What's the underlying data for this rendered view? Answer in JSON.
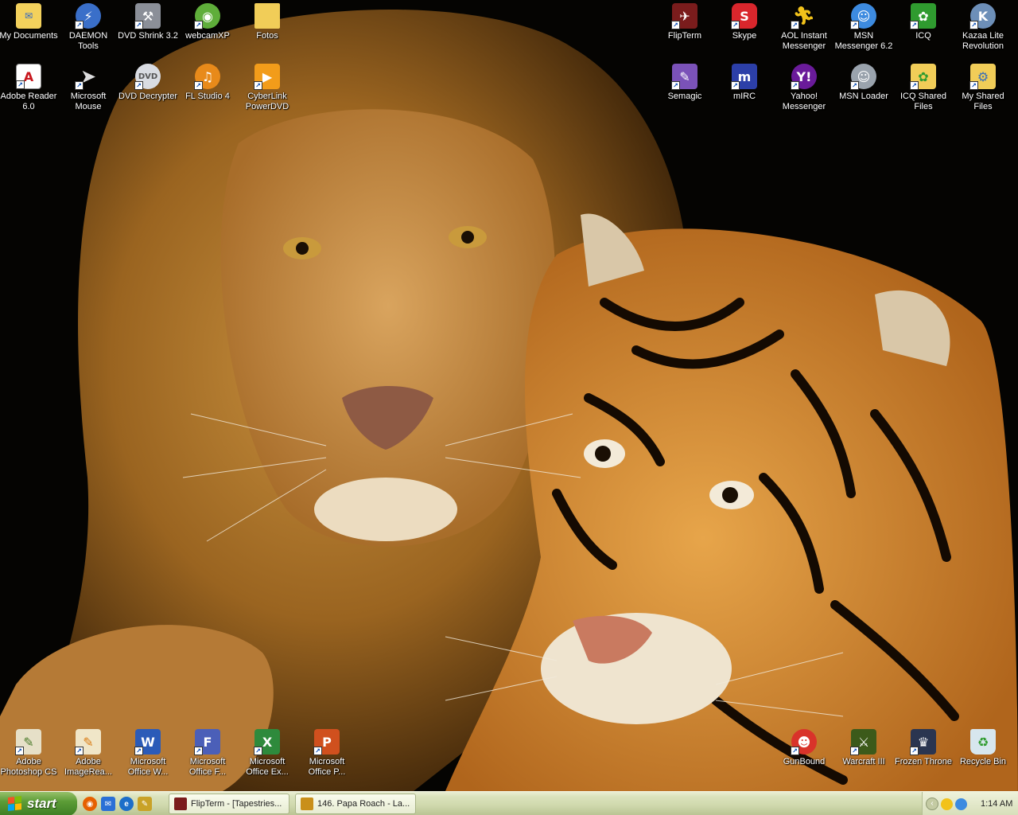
{
  "desktop": {
    "icons": [
      {
        "label": "My Documents",
        "icon": "folder-documents-icon"
      },
      {
        "label": "DAEMON Tools",
        "icon": "daemon-tools-icon"
      },
      {
        "label": "DVD Shrink 3.2",
        "icon": "dvd-shrink-icon"
      },
      {
        "label": "webcamXP",
        "icon": "webcam-icon"
      },
      {
        "label": "Fotos",
        "icon": "folder-icon"
      },
      {
        "label": "Adobe Reader 6.0",
        "icon": "adobe-reader-icon"
      },
      {
        "label": "Microsoft Mouse",
        "icon": "mouse-pointer-icon"
      },
      {
        "label": "DVD Decrypter",
        "icon": "dvd-disc-icon"
      },
      {
        "label": "FL Studio 4",
        "icon": "fl-studio-icon"
      },
      {
        "label": "CyberLink PowerDVD",
        "icon": "powerdvd-icon"
      },
      {
        "label": "FlipTerm",
        "icon": "flipterm-icon"
      },
      {
        "label": "Skype",
        "icon": "skype-icon"
      },
      {
        "label": "AOL Instant Messenger",
        "icon": "aim-running-man-icon"
      },
      {
        "label": "MSN Messenger 6.2",
        "icon": "msn-buddies-icon"
      },
      {
        "label": "ICQ",
        "icon": "icq-flower-icon"
      },
      {
        "label": "Kazaa Lite Revolution",
        "icon": "kazaa-icon"
      },
      {
        "label": "Semagic",
        "icon": "semagic-pen-icon"
      },
      {
        "label": "mIRC",
        "icon": "mirc-icon"
      },
      {
        "label": "Yahoo! Messenger",
        "icon": "yahoo-messenger-icon"
      },
      {
        "label": "MSN Loader",
        "icon": "msn-loader-icon"
      },
      {
        "label": "ICQ Shared Files",
        "icon": "icq-shared-folder-icon"
      },
      {
        "label": "My Shared Files",
        "icon": "shared-folder-icon"
      },
      {
        "label": "Adobe Photoshop CS",
        "icon": "photoshop-icon"
      },
      {
        "label": "Adobe ImageRea...",
        "icon": "imageready-icon"
      },
      {
        "label": "Microsoft Office W...",
        "icon": "word-icon"
      },
      {
        "label": "Microsoft Office F...",
        "icon": "frontpage-icon"
      },
      {
        "label": "Microsoft Office Ex...",
        "icon": "excel-icon"
      },
      {
        "label": "Microsoft Office P...",
        "icon": "powerpoint-icon"
      },
      {
        "label": "GunBound",
        "icon": "gunbound-icon"
      },
      {
        "label": "Warcraft III",
        "icon": "warcraft-icon"
      },
      {
        "label": "Frozen Throne",
        "icon": "frozen-throne-icon"
      },
      {
        "label": "Recycle Bin",
        "icon": "recycle-bin-icon"
      }
    ]
  },
  "taskbar": {
    "start_label": "start",
    "quick_launch": [
      {
        "icon": "firefox-icon",
        "color": "#e66000"
      },
      {
        "icon": "outlook-express-icon",
        "color": "#2a6fd6"
      },
      {
        "icon": "internet-explorer-icon",
        "color": "#1d6ec9"
      },
      {
        "icon": "pen-tool-icon",
        "color": "#c9a227"
      }
    ],
    "tasks": [
      {
        "label": "FlipTerm - [Tapestries...",
        "icon": "flipterm-icon"
      },
      {
        "label": "146. Papa Roach - La...",
        "icon": "winamp-icon"
      }
    ],
    "tray": {
      "clock": "1:14 AM",
      "icons": [
        "msn-tray-icon",
        "aim-tray-icon"
      ]
    }
  }
}
